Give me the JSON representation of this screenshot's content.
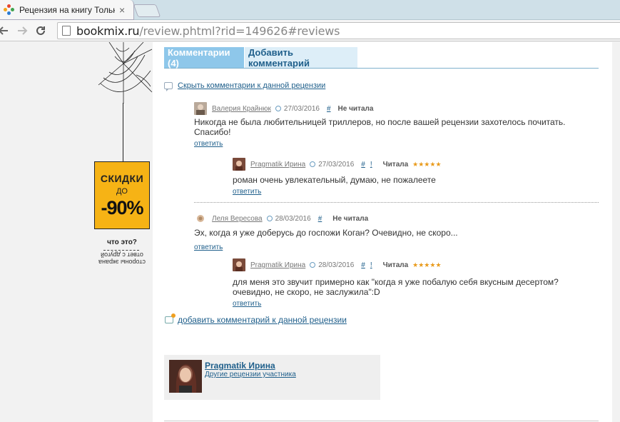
{
  "browser": {
    "tab_title": "Рецензия на книгу Тольк",
    "close_glyph": "×",
    "url_host": "bookmix.ru",
    "url_rest": "/review.phtml?rid=149626#reviews"
  },
  "promo": {
    "line1": "СКИДКИ",
    "line2": "ДО",
    "line3": "-90%",
    "what": "что это?",
    "flipped_1": "ответ с другой",
    "flipped_2": "стороны экрана"
  },
  "tabs": {
    "comments": "Комментарии (4)",
    "add": "Добавить комментарий"
  },
  "hide_link": "Скрыть комментарии к данной рецензии",
  "comments": [
    {
      "author": "Валерия Крайнюк",
      "date": "27/03/2016",
      "hash": "#",
      "excl": "",
      "status": "Не читала",
      "stars": "",
      "text": "Никогда не была любительницей триллеров, но после вашей рецензии захотелось почитать. Спасибо!",
      "reply": "ответить"
    },
    {
      "author": "Pragmatik Ирина",
      "date": "27/03/2016",
      "hash": "#",
      "excl": "!",
      "status": "Читала",
      "stars": "★★★★★",
      "text": "роман очень увлекательный, думаю, не пожалеете",
      "reply": "ответить"
    },
    {
      "author": "Леля Вересова",
      "date": "28/03/2016",
      "hash": "#",
      "excl": "",
      "status": "Не читала",
      "stars": "",
      "text": "Эх, когда я уже доберусь до госпожи Коган? Очевидно, не скоро...",
      "reply": "ответить"
    },
    {
      "author": "Pragmatik Ирина",
      "date": "28/03/2016",
      "hash": "#",
      "excl": "!",
      "status": "Читала",
      "stars": "★★★★★",
      "text": "для меня это звучит примерно как \"когда я уже побалую себя вкусным десертом? очевидно, не скоро, не заслужила\":D",
      "reply": "ответить"
    }
  ],
  "add_comment": "добавить комментарий к данной рецензии",
  "author_card": {
    "name": "Pragmatik Ирина",
    "other": "Другие рецензии участника"
  },
  "colors": {
    "tab_active": "#8ec7ea",
    "tab_inactive": "#ddeef8",
    "link": "#1f5f8b",
    "sale_yellow": "#f6b315",
    "stars": "#e99a1a"
  }
}
